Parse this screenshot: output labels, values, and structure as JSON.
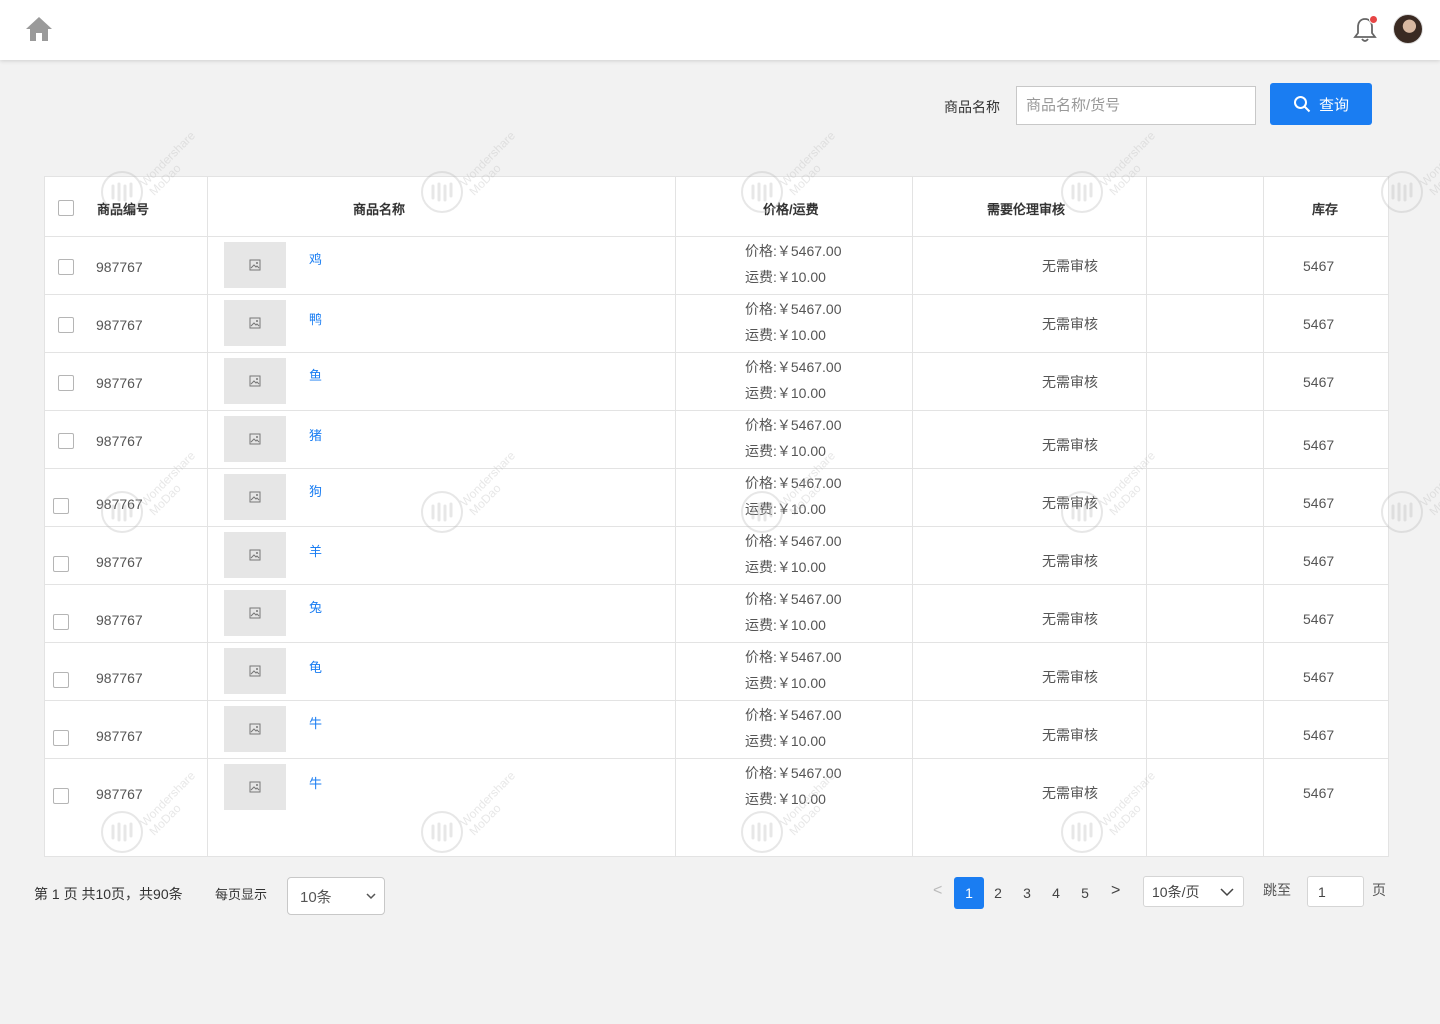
{
  "search": {
    "label": "商品名称",
    "placeholder": "商品名称/货号",
    "button_label": "查询"
  },
  "table": {
    "headers": {
      "code": "商品编号",
      "name": "商品名称",
      "price": "价格/运费",
      "review": "需要伦理审核",
      "blank": "",
      "stock": "库存"
    },
    "rows": [
      {
        "code": "987767",
        "name": "鸡",
        "price": "价格:￥5467.00",
        "freight": "运费:￥10.00",
        "review": "无需审核",
        "stock": "5467"
      },
      {
        "code": "987767",
        "name": "鸭",
        "price": "价格:￥5467.00",
        "freight": "运费:￥10.00",
        "review": "无需审核",
        "stock": "5467"
      },
      {
        "code": "987767",
        "name": "鱼",
        "price": "价格:￥5467.00",
        "freight": "运费:￥10.00",
        "review": "无需审核",
        "stock": "5467"
      },
      {
        "code": "987767",
        "name": "猪",
        "price": "价格:￥5467.00",
        "freight": "运费:￥10.00",
        "review": "无需审核",
        "stock": "5467"
      },
      {
        "code": "987767",
        "name": "狗",
        "price": "价格:￥5467.00",
        "freight": "运费:￥10.00",
        "review": "无需审核",
        "stock": "5467"
      },
      {
        "code": "987767",
        "name": "羊",
        "price": "价格:￥5467.00",
        "freight": "运费:￥10.00",
        "review": "无需审核",
        "stock": "5467"
      },
      {
        "code": "987767",
        "name": "兔",
        "price": "价格:￥5467.00",
        "freight": "运费:￥10.00",
        "review": "无需审核",
        "stock": "5467"
      },
      {
        "code": "987767",
        "name": "龟",
        "price": "价格:￥5467.00",
        "freight": "运费:￥10.00",
        "review": "无需审核",
        "stock": "5467"
      },
      {
        "code": "987767",
        "name": "牛",
        "price": "价格:￥5467.00",
        "freight": "运费:￥10.00",
        "review": "无需审核",
        "stock": "5467"
      },
      {
        "code": "987767",
        "name": "牛",
        "price": "价格:￥5467.00",
        "freight": "运费:￥10.00",
        "review": "无需审核",
        "stock": "5467"
      }
    ]
  },
  "pagination": {
    "info": "第 1 页 共10页，共90条",
    "per_page_label": "每页显示",
    "per_page_value": "10条",
    "prev": "<",
    "next": ">",
    "pages": [
      "1",
      "2",
      "3",
      "4",
      "5"
    ],
    "current_page": "1",
    "page_size": "10条/页",
    "jump_label": "跳至",
    "jump_value": "1",
    "page_suffix": "页"
  },
  "watermark": {
    "line1": "Wondershare",
    "line2": "MoDao"
  },
  "colors": {
    "accent": "#1a7df2",
    "notification": "#e64545"
  }
}
